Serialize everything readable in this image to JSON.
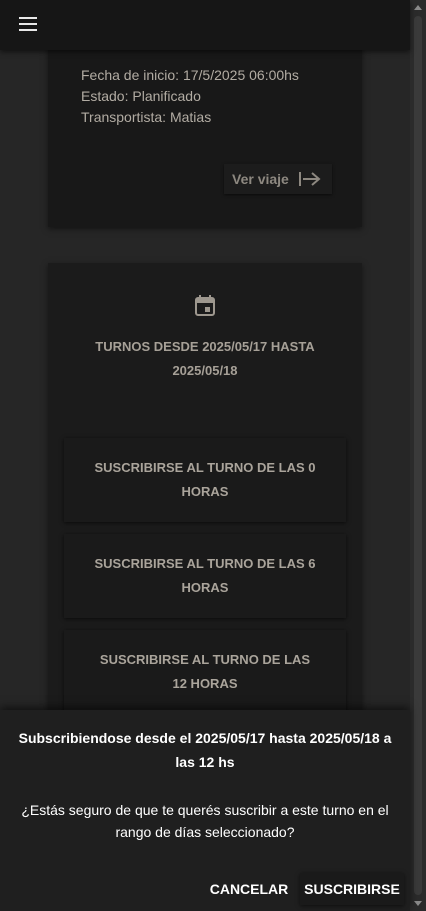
{
  "header": {
    "menu_icon": "menu-icon"
  },
  "trip": {
    "start_date": "Fecha de inicio: 17/5/2025 06:00hs",
    "status": "Estado: Planificado",
    "driver": "Transportista: Matias",
    "view_trip_label": "Ver viaje",
    "view_trip_icon": "arrow-right-to-line-icon"
  },
  "turnos": {
    "calendar_icon": "calendar-icon",
    "title_line1": "TURNOS DESDE 2025/05/17 HASTA",
    "title_line2": "2025/05/18",
    "shifts": [
      {
        "line1": "SUSCRIBIRSE AL TURNO DE LAS 0",
        "line2": "HORAS"
      },
      {
        "line1": "SUSCRIBIRSE AL TURNO DE LAS 6",
        "line2": "HORAS"
      },
      {
        "line1": "SUSCRIBIRSE AL TURNO DE LAS",
        "line2": "12 HORAS"
      }
    ]
  },
  "dialog": {
    "title_line1": "Subscribiendose desde el 2025/05/17 hasta 2025/05/18 a",
    "title_line2": "las 12 hs",
    "body_line1": "¿Estás seguro de que te querés suscribir a este turno en el",
    "body_line2": "rango de días seleccionado?",
    "cancel_label": "CANCELAR",
    "confirm_label": "SUSCRIBIRSE"
  },
  "colors": {
    "background": "#262626",
    "card": "#181818",
    "muted_text": "#b2aca3",
    "dialog_text": "#ffffff"
  }
}
